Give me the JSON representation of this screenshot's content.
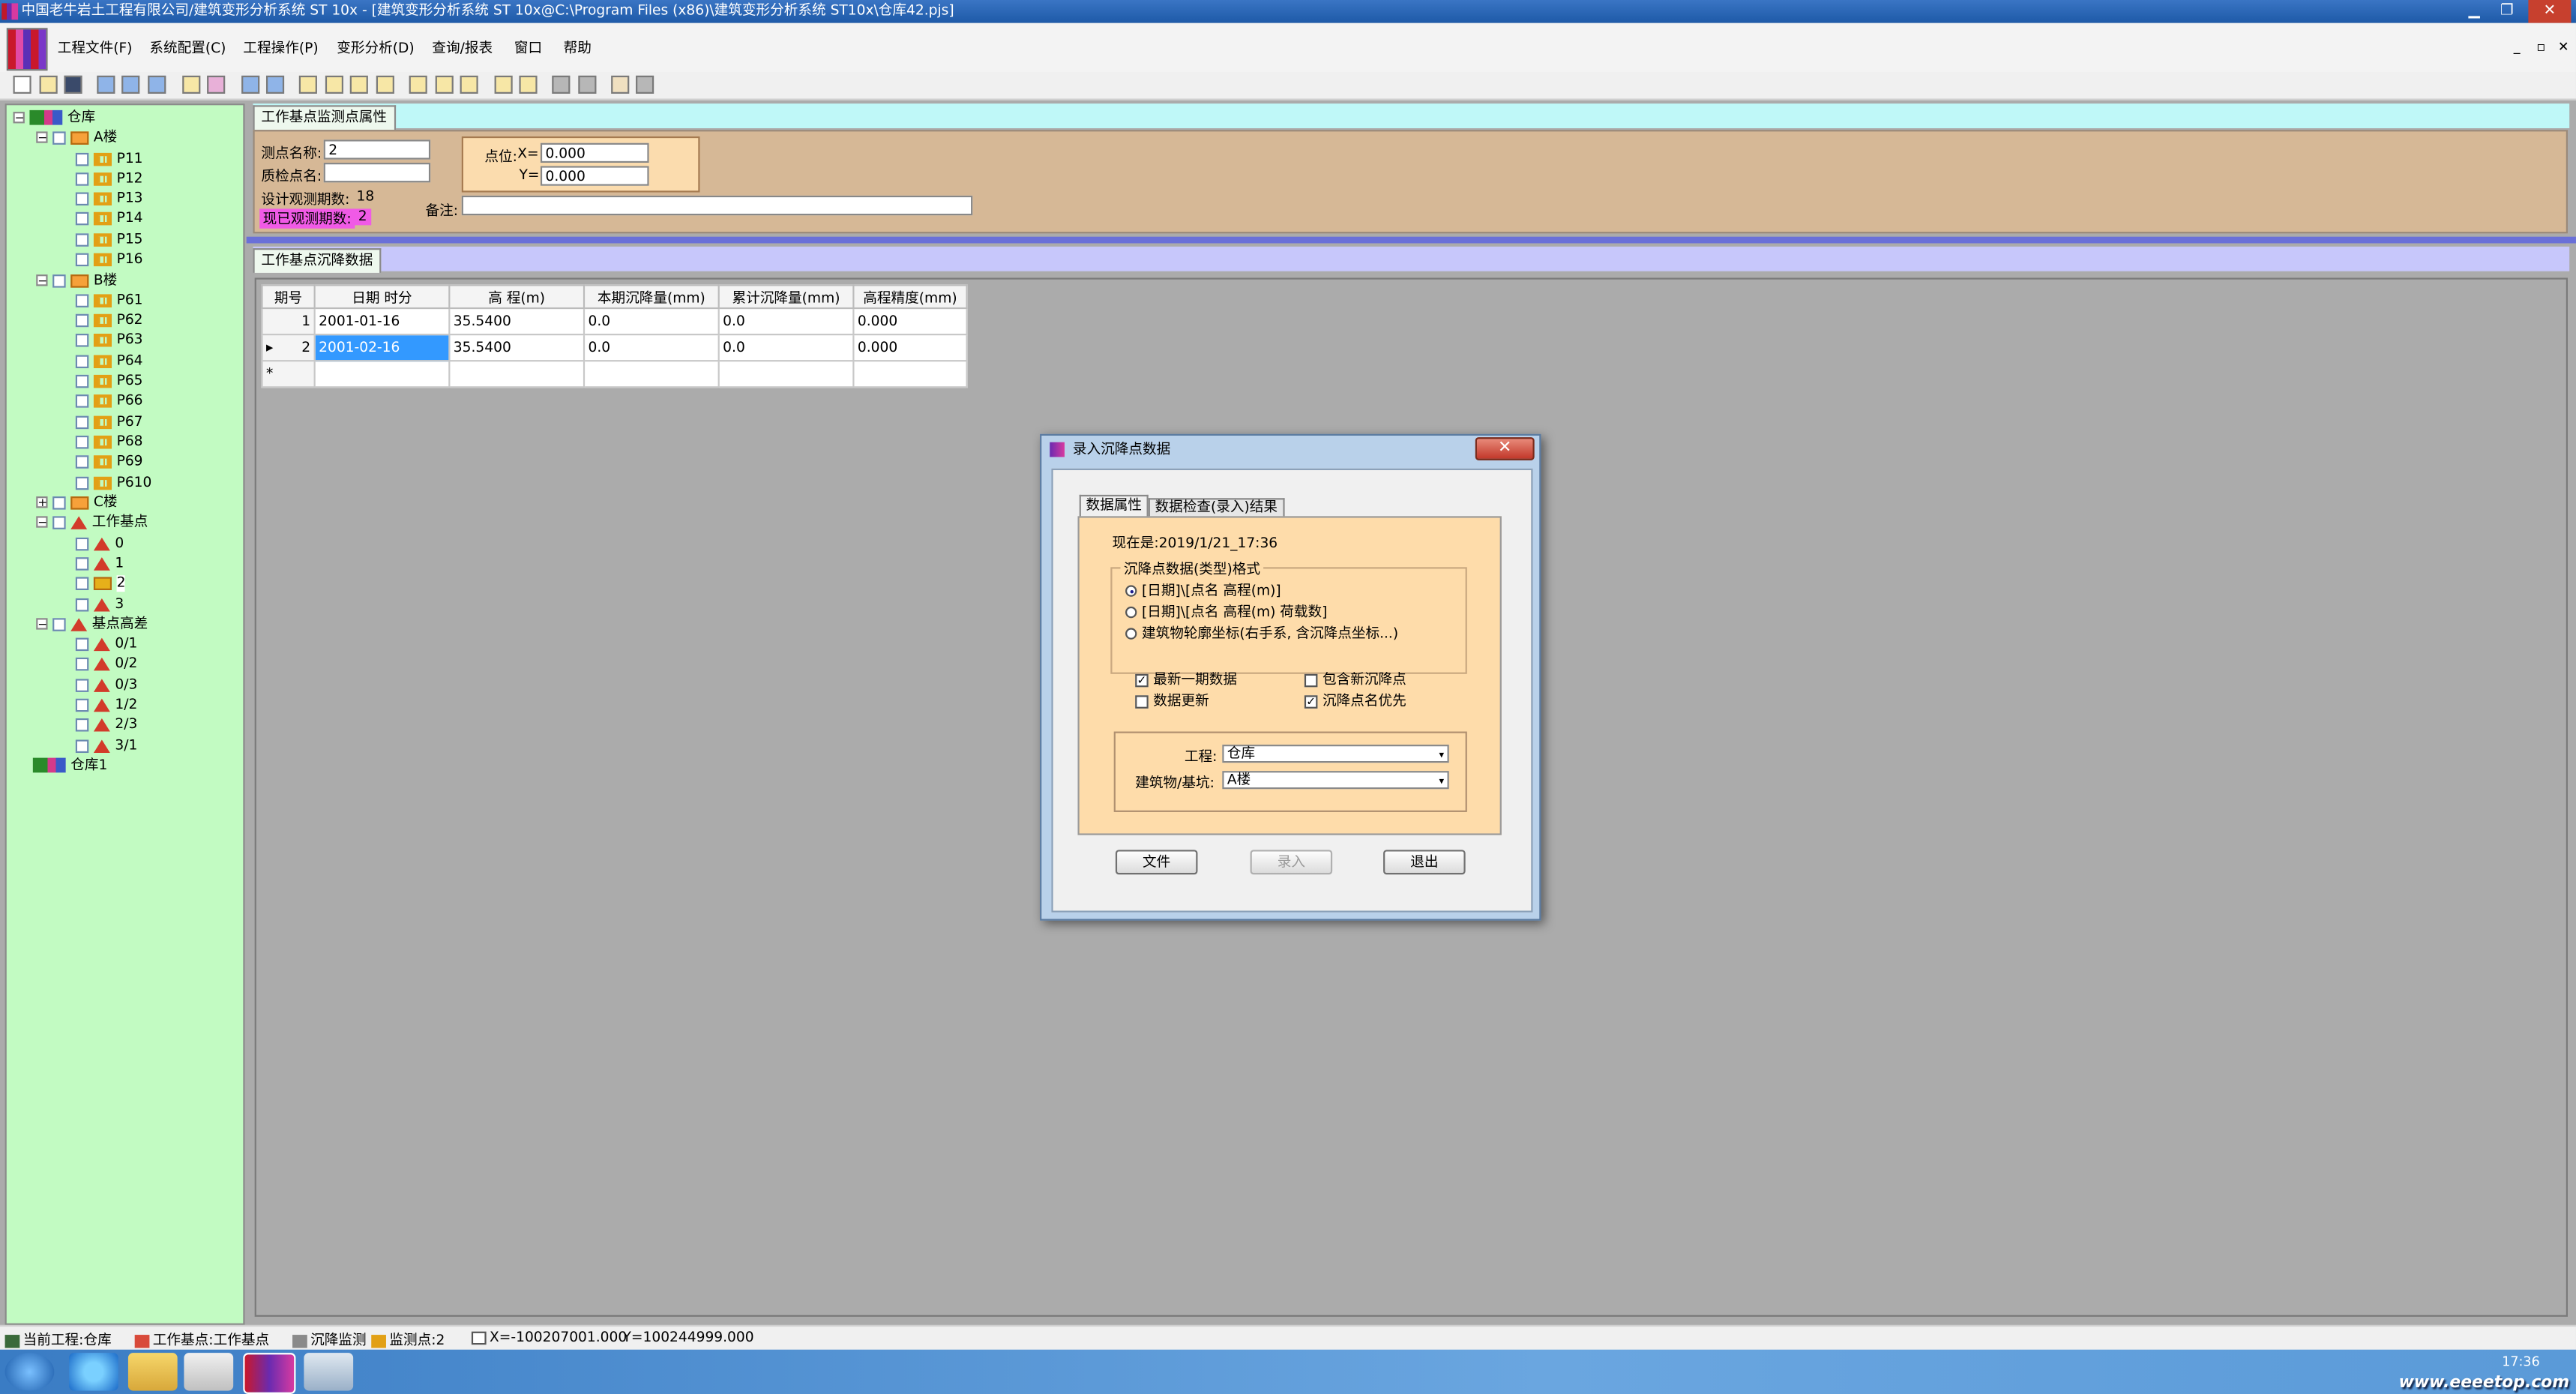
{
  "window": {
    "title": "中国老牛岩土工程有限公司/建筑变形分析系统 ST 10x - [建筑变形分析系统 ST 10x@C:\\Program Files (x86)\\建筑变形分析系统 ST10x\\仓库42.pjs]",
    "min": "▁",
    "max": "❐",
    "close": "✕"
  },
  "menu": {
    "items": [
      "工程文件(F)",
      "系统配置(C)",
      "工程操作(P)",
      "变形分析(D)",
      "查询/报表",
      "窗口",
      "帮助"
    ],
    "mdi_min": "_",
    "mdi_max": "▫",
    "mdi_close": "✕"
  },
  "tree": {
    "project1": "仓库",
    "bldgA": "A楼",
    "pointsA": [
      "P11",
      "P12",
      "P13",
      "P14",
      "P15",
      "P16"
    ],
    "bldgB": "B楼",
    "pointsB": [
      "P61",
      "P62",
      "P63",
      "P64",
      "P65",
      "P66",
      "P67",
      "P68",
      "P69",
      "P610"
    ],
    "bldgC": "C楼",
    "workbase": "工作基点",
    "workpoints": [
      "0",
      "1",
      "2",
      "3"
    ],
    "basediff": "基点高差",
    "diffs": [
      "0/1",
      "0/2",
      "0/3",
      "1/2",
      "2/3",
      "3/1"
    ],
    "project2": "仓库1",
    "plus": "+",
    "minus": "−"
  },
  "props": {
    "tab": "工作基点监测点属性",
    "name_label": "测点名称:",
    "name_value": "2",
    "check_label": "质检点名:",
    "check_value": "",
    "design_label": "设计观测期数:",
    "design_value": "18",
    "observed_label": "现已观测期数:",
    "observed_value": "2",
    "pos_label": "点位:",
    "x_label": "X=",
    "x_value": "0.000",
    "y_label": "Y=",
    "y_value": "0.000",
    "remark_label": "备注:",
    "remark_value": ""
  },
  "grid": {
    "tab": "工作基点沉降数据",
    "columns": [
      "期号",
      "日期 时分",
      "高 程(m)",
      "本期沉降量(mm)",
      "累计沉降量(mm)",
      "高程精度(mm)"
    ],
    "rows": [
      {
        "marker": "",
        "id": "1",
        "date": "2001-01-16",
        "elev": "35.5400",
        "cur": "0.0",
        "cum": "0.0",
        "prec": "0.000"
      },
      {
        "marker": "▸",
        "id": "2",
        "date": "2001-02-16",
        "elev": "35.5400",
        "cur": "0.0",
        "cum": "0.0",
        "prec": "0.000"
      }
    ],
    "new_marker": "*"
  },
  "dialog": {
    "title": "录入沉降点数据",
    "close": "✕",
    "tab1": "数据属性",
    "tab2": "数据检查(录入)结果",
    "now": "现在是:2019/1/21_17:36",
    "format_group": "沉降点数据(类型)格式",
    "radios": [
      "[日期]\\[点名 高程(m)]",
      "[日期]\\[点名 高程(m) 荷载数]",
      "建筑物轮廓坐标(右手系, 含沉降点坐标...)"
    ],
    "chk_latest": "最新一期数据",
    "chk_latest_on": "✓",
    "chk_update": "数据更新",
    "chk_include": "包含新沉降点",
    "chk_priority": "沉降点名优先",
    "chk_priority_on": "✓",
    "project_label": "工程:",
    "project_value": "仓库",
    "building_label": "建筑物/基坑:",
    "building_value": "A楼",
    "arrow": "▾",
    "btn_file": "文件",
    "btn_enter": "录入",
    "btn_exit": "退出"
  },
  "status": {
    "project": "当前工程:仓库",
    "workbase": "工作基点:工作基点",
    "monitor": "沉降监测",
    "point": "监测点:2",
    "x": "X=-100207001.000",
    "y": "Y=100244999.000"
  },
  "taskbar": {
    "time": "17:36",
    "watermark": "www.eeeetop.com"
  }
}
